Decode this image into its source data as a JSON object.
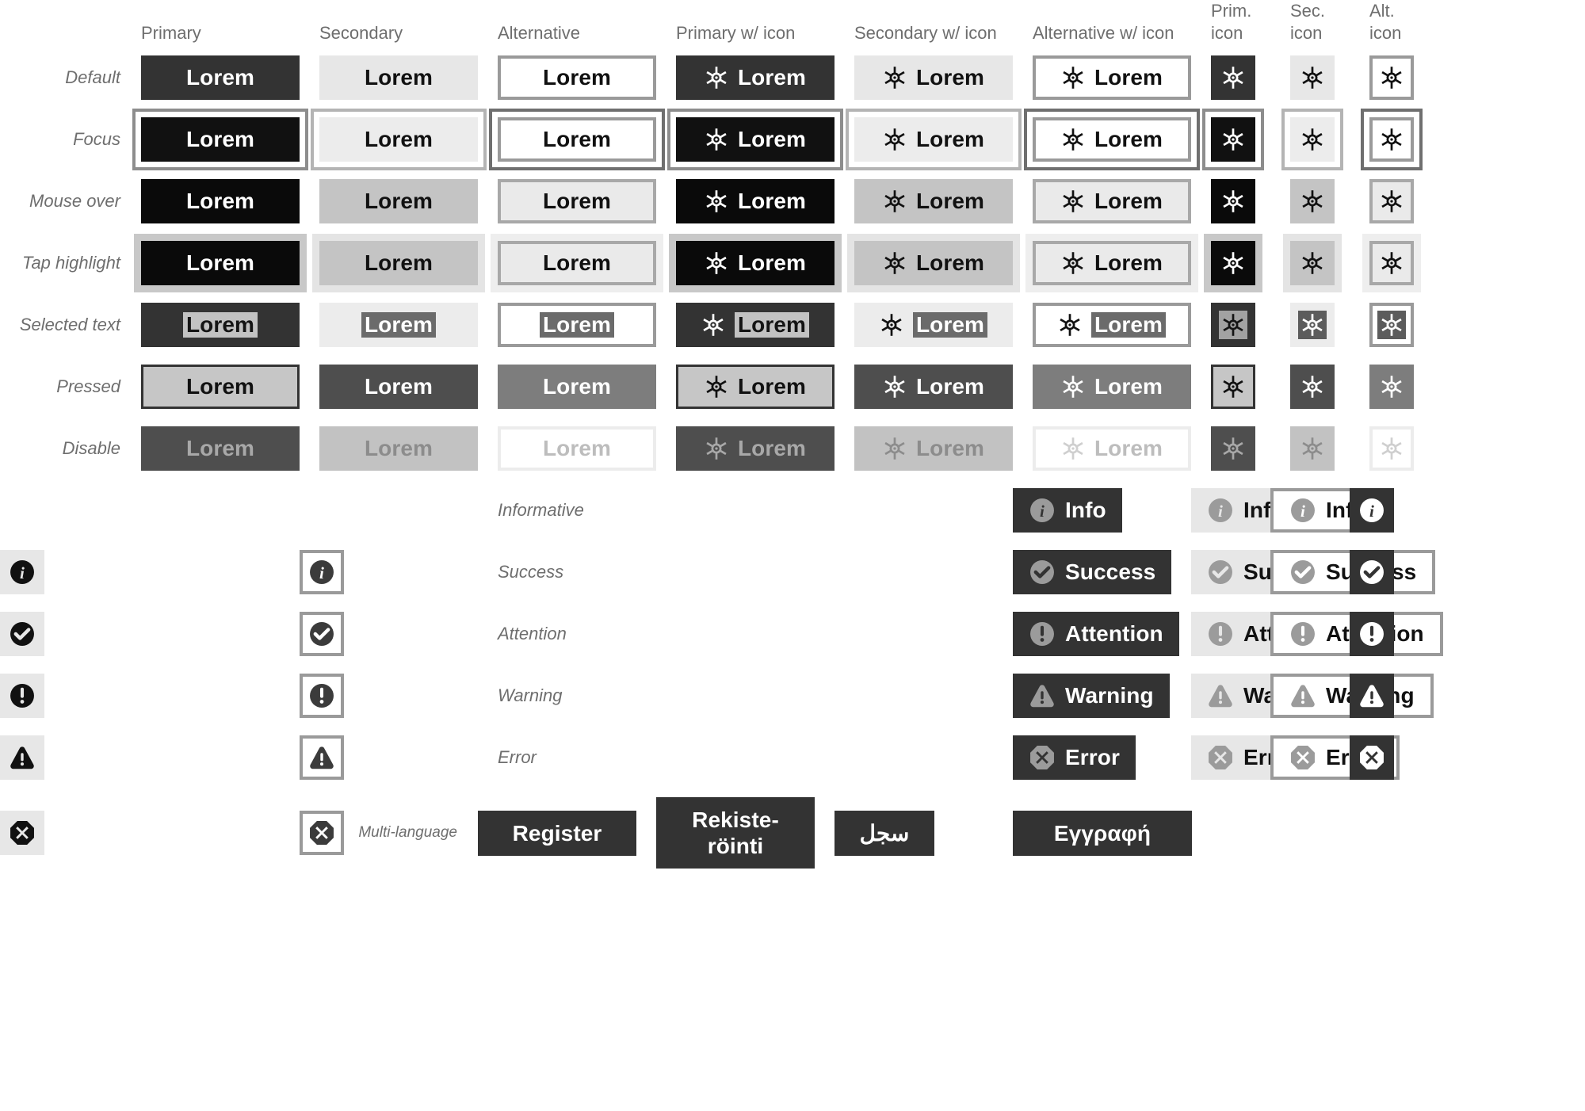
{
  "columns": [
    {
      "id": "primary",
      "label": "Primary"
    },
    {
      "id": "secondary",
      "label": "Secondary"
    },
    {
      "id": "alternative",
      "label": "Alternative"
    },
    {
      "id": "primary_icon",
      "label": "Primary w/ icon"
    },
    {
      "id": "secondary_icon",
      "label": "Secondary w/ icon"
    },
    {
      "id": "alternative_icon",
      "label": "Alternative w/ icon"
    },
    {
      "id": "prim_icon_only",
      "label": "Prim.\nicon"
    },
    {
      "id": "sec_icon_only",
      "label": "Sec.\nicon"
    },
    {
      "id": "alt_icon_only",
      "label": "Alt.\nicon"
    }
  ],
  "state_rows": [
    {
      "id": "default",
      "label": "Default"
    },
    {
      "id": "focus",
      "label": "Focus"
    },
    {
      "id": "mouseover",
      "label": "Mouse over"
    },
    {
      "id": "tap",
      "label": "Tap highlight"
    },
    {
      "id": "selected",
      "label": "Selected text"
    },
    {
      "id": "pressed",
      "label": "Pressed"
    },
    {
      "id": "disable",
      "label": "Disable"
    }
  ],
  "status_rows": [
    {
      "id": "informative",
      "label": "Informative",
      "button_text": "Info",
      "icon": "info-icon"
    },
    {
      "id": "success",
      "label": "Success",
      "button_text": "Success",
      "icon": "check-circle-icon"
    },
    {
      "id": "attention",
      "label": "Attention",
      "button_text": "Attention",
      "icon": "exclamation-circle-icon"
    },
    {
      "id": "warning",
      "label": "Warning",
      "button_text": "Warning",
      "icon": "warning-triangle-icon"
    },
    {
      "id": "error",
      "label": "Error",
      "button_text": "Error",
      "icon": "error-octagon-icon"
    }
  ],
  "multilanguage": {
    "label": "Multi-language",
    "buttons": [
      {
        "id": "en",
        "text": "Register"
      },
      {
        "id": "fi",
        "text": "Rekiste-\nröinti"
      },
      {
        "id": "ar",
        "text": "سجل"
      },
      {
        "id": "el",
        "text": "Εγγραφή"
      }
    ]
  },
  "button_label": "Lorem",
  "icon_name": "brightness-icon",
  "colors": {
    "primary_fill": "#333333",
    "primary_focus_fill": "#111111",
    "primary_hover_fill": "#0a0a0a",
    "primary_pressed_fill": "#c6c6c6",
    "primary_disabled_fill": "#4e4e4e",
    "secondary_fill": "#e7e7e7",
    "secondary_hover_fill": "#c4c4c4",
    "secondary_pressed_fill": "#4e4e4e",
    "secondary_disabled_fill": "#c2c2c2",
    "alternative_border": "#9a9a9a",
    "alternative_pressed_fill": "#7d7d7d",
    "text_on_dark": "#ffffff",
    "text_on_light": "#111111",
    "disabled_text": "#a8a8a8",
    "label_text": "#6e6e6e",
    "focus_ring": "#8d8d8d",
    "selection_on_dark": "#c2c2c2",
    "selection_on_light": "#6b6b6b",
    "status_icon_muted": "#9b9b9b",
    "page_background": "#ffffff"
  }
}
